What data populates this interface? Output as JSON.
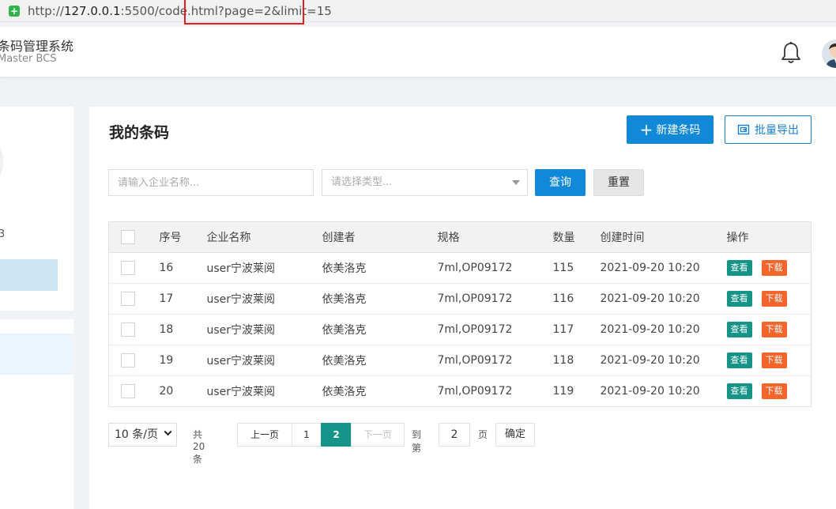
{
  "browser": {
    "url_prefix": "http://",
    "url_host": "127.0.0.1",
    "url_rest": ":5500/code.html?page=2&limit=15"
  },
  "header": {
    "app_title": "条码管理系统",
    "app_subtitle": "Master BCS"
  },
  "sidebar": {
    "partial_text": "3"
  },
  "main": {
    "title": "我的条码",
    "new_button": "新建条码",
    "new_button_icon": "+",
    "export_button": "批量导出",
    "company_placeholder": "请输入企业名称...",
    "type_placeholder": "请选择类型...",
    "query_button": "查询",
    "reset_button": "重置"
  },
  "table": {
    "headers": [
      "序号",
      "企业名称",
      "创建者",
      "规格",
      "数量",
      "创建时间",
      "操作"
    ],
    "rows": [
      {
        "no": "16",
        "company": "user宁波莱阅",
        "creator": "依美洛克",
        "spec": "7ml,OP09172",
        "qty": "115",
        "time": "2021-09-20 10:20"
      },
      {
        "no": "17",
        "company": "user宁波莱阅",
        "creator": "依美洛克",
        "spec": "7ml,OP09172",
        "qty": "116",
        "time": "2021-09-20 10:20"
      },
      {
        "no": "18",
        "company": "user宁波莱阅",
        "creator": "依美洛克",
        "spec": "7ml,OP09172",
        "qty": "117",
        "time": "2021-09-20 10:20"
      },
      {
        "no": "19",
        "company": "user宁波莱阅",
        "creator": "依美洛克",
        "spec": "7ml,OP09172",
        "qty": "118",
        "time": "2021-09-20 10:20"
      },
      {
        "no": "20",
        "company": "user宁波莱阅",
        "creator": "依美洛克",
        "spec": "7ml,OP09172",
        "qty": "119",
        "time": "2021-09-20 10:20"
      }
    ],
    "view_label": "查看",
    "download_label": "下载",
    "view_color": "#169487",
    "download_color": "#f4652b"
  },
  "pagination": {
    "page_size": "10 条/页",
    "total": "共 20 条",
    "prev": "上一页",
    "pages": [
      "1",
      "2"
    ],
    "current_page": "2",
    "next": "下一页",
    "goto_label": "到第",
    "goto_value": "2",
    "page_unit": "页",
    "confirm": "确定"
  },
  "colors": {
    "primary": "#1188d8",
    "pager_active": "#16948a"
  }
}
